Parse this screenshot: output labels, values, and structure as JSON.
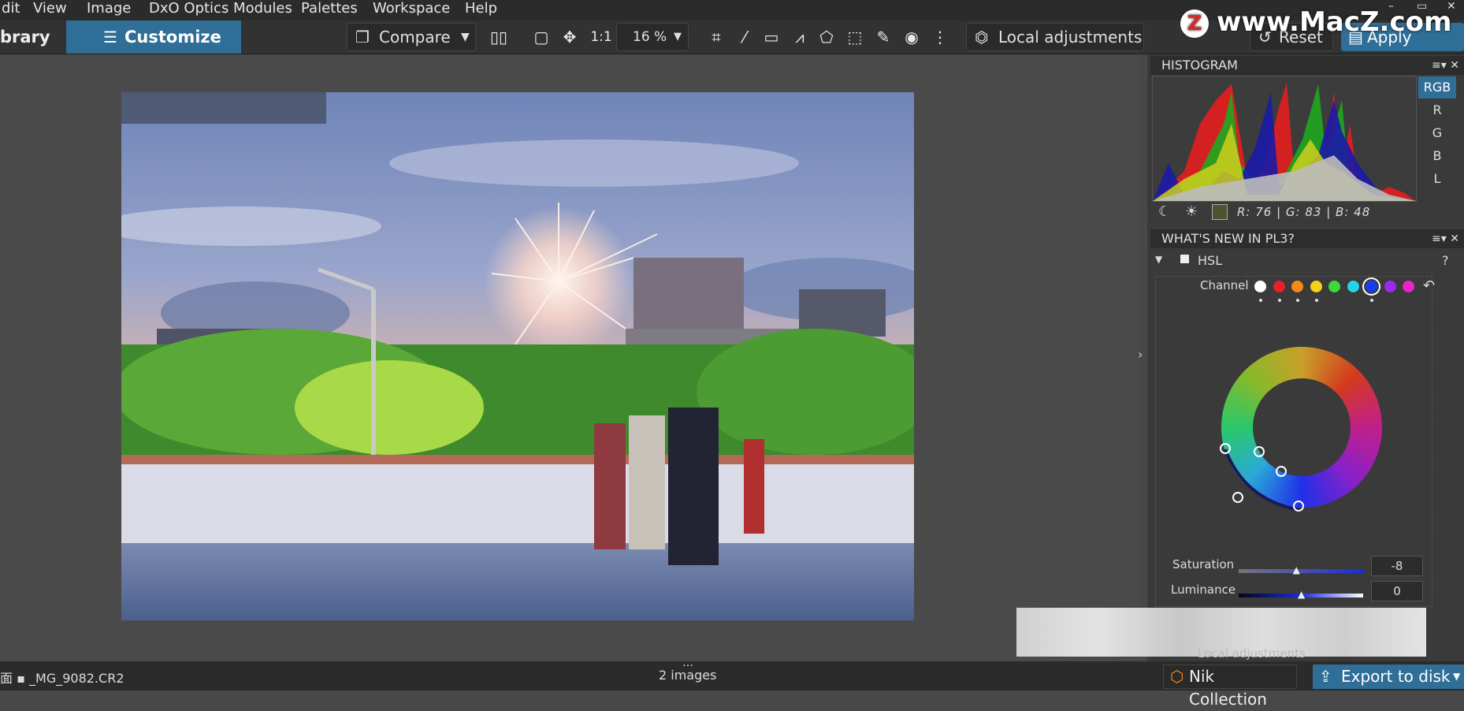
{
  "menu": [
    "dit",
    "View",
    "Image",
    "DxO Optics Modules",
    "Palettes",
    "Workspace",
    "Help"
  ],
  "window_controls": [
    "–",
    "▭",
    "✕"
  ],
  "watermark": "www.MacZ.com",
  "toolbar": {
    "library_tab": "brary",
    "customize_tab": "Customize",
    "compare_label": "Compare",
    "ratio_label": "1:1",
    "zoom_value": "16 %",
    "local_adjustments": "Local adjustments",
    "reset_label": "Reset",
    "apply_preset_label": "Apply preset"
  },
  "histogram": {
    "title": "HISTOGRAM",
    "channels": [
      "RGB",
      "R",
      "G",
      "B",
      "L"
    ],
    "active_channel": "RGB",
    "readout": "R:  76  |  G:  83  |  B:  48",
    "sample_color": "#4e5330"
  },
  "whats_new": {
    "title": "WHAT'S NEW IN PL3?",
    "section": "HSL",
    "help": "?",
    "channel_label": "Channel",
    "channel_colors": [
      "#ffffff",
      "#e8202a",
      "#f28a1c",
      "#f2d21c",
      "#3fd83a",
      "#25d4e6",
      "#1a3cf0",
      "#9a2af0",
      "#e626c8"
    ],
    "selected_channel": 6,
    "saturation_label": "Saturation",
    "saturation_value": "-8",
    "saturation_level": 0.46,
    "luminance_label": "Luminance",
    "luminance_value": "0",
    "luminance_level": 0.5,
    "local_adjustments_label": "Local adjustments"
  },
  "status": {
    "filename": "面 ▪ _MG_9082.CR2",
    "image_count": "2 images",
    "nik_collection": "Nik Collection",
    "export_to_disk": "Export to disk"
  },
  "colors": {
    "accent": "#2f6e96"
  }
}
